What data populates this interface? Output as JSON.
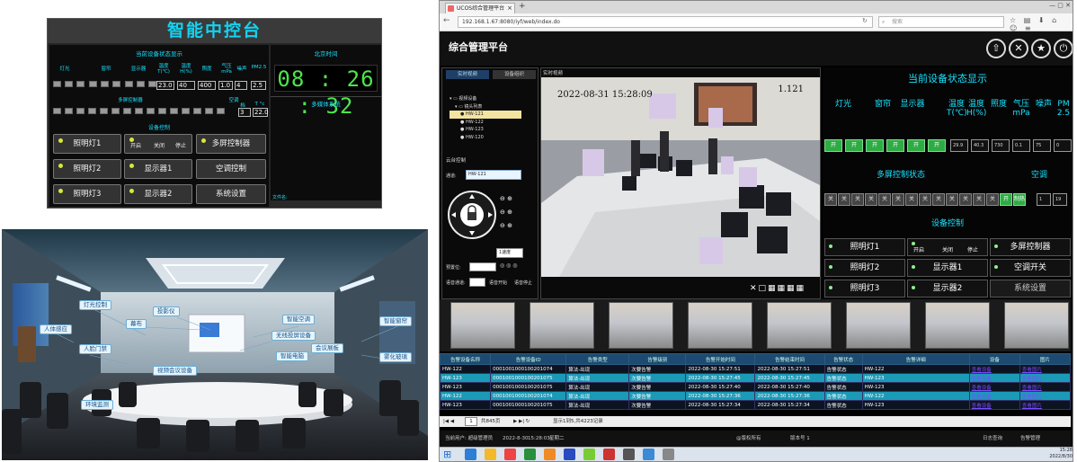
{
  "console": {
    "title": "智能中控台",
    "status_title": "当前设备状态显示",
    "time_title": "北京时间",
    "clock": "08 : 26 : 32",
    "labels": [
      "灯光",
      "窗帘",
      "显示器",
      "温度 T(℃)",
      "温度 H(%)",
      "照度",
      "气压 mPa",
      "噪声",
      "PM2.5"
    ],
    "values": [
      "23.0",
      "40",
      "400",
      "1.0",
      "4",
      "2.5"
    ],
    "multi_title": "多屏控制器",
    "ac_title": "空调",
    "ac_sub": [
      "档",
      "T °c"
    ],
    "ac_values": [
      "3",
      "22.0"
    ],
    "media_title": "多媒体系统",
    "device_title": "设备控制",
    "buttons": [
      "照明灯1",
      "照明灯2",
      "照明灯3",
      "显示器1",
      "显示器2",
      "多屏控制器",
      "空调控制",
      "系统设置"
    ],
    "small_buttons": [
      "开启",
      "关闭",
      "停止"
    ],
    "file_label": "文件名:"
  },
  "room": {
    "tags": [
      "灯光控制",
      "幕布",
      "投影仪",
      "智能空调",
      "智能窗帘",
      "人体感应",
      "人脸门禁",
      "无线投屏设备",
      "智能电脑",
      "会议展板",
      "雾化玻璃",
      "视频会议设备",
      "环境监测"
    ]
  },
  "browser": {
    "tab_title": "UCOS综合管理平台",
    "url": "192.168.1.67:8080/iyf/web/index.do",
    "search_placeholder": "搜索",
    "app_title": "综合管理平台",
    "sub_tabs": [
      "实时视频",
      "设备组织"
    ],
    "video_header": "实时视频",
    "tree": [
      "视频设备",
      "镜头列表",
      "HW-121",
      "HW-122",
      "HW-123",
      "HW-120"
    ],
    "ptz_title": "云台控制",
    "channel_label": "通道:",
    "channel_value": "HW-121",
    "speed_value": "1速度",
    "preset_label": "预置位:",
    "voice_label": "语音通道:",
    "voice_buttons": [
      "语音开始",
      "语音停止"
    ],
    "osd_time": "2022-08-31 15:28:09",
    "osd_channel": "1.121",
    "status_title": "当前设备状态显示",
    "status_labels": [
      "灯光",
      "窗帘",
      "显示器",
      "温度 T(℃)",
      "温度 H(%)",
      "照度",
      "气压 mPa",
      "噪声",
      "PM 2.5"
    ],
    "status_switches": [
      "开",
      "开",
      "开",
      "开",
      "开",
      "开"
    ],
    "status_values": [
      "29.9",
      "40.3",
      "730",
      "0.1",
      "75",
      "0"
    ],
    "multi_title": "多屏控制状态",
    "ac_title": "空调",
    "multi_switches": [
      "关",
      "关",
      "关",
      "关",
      "关",
      "关",
      "关",
      "关",
      "关",
      "关",
      "关",
      "关",
      "关",
      "开",
      "制热"
    ],
    "ac_values": [
      "1",
      "19"
    ],
    "device_title": "设备控制",
    "device_buttons": [
      "照明灯1",
      "照明灯2",
      "照明灯3",
      "显示器1",
      "显示器2",
      "多屏控制器",
      "空调开关",
      "系统设置"
    ],
    "small_buttons": [
      "开启",
      "关闭",
      "停止"
    ],
    "table_headers": [
      "告警设备名称",
      "告警设备ID",
      "告警类型",
      "告警级别",
      "告警开始时间",
      "告警结束时间",
      "告警状态",
      "告警详细",
      "设备",
      "图片"
    ],
    "table_rows": [
      [
        "HW-122",
        "0001001000100201074",
        "算法-出现",
        "次要告警",
        "2022-08-30 15:27:51",
        "2022-08-30 15:27:51",
        "告警状态",
        "HW-122",
        "查看设备",
        "查看图片"
      ],
      [
        "HW-123",
        "0001001000100201075",
        "算法-出现",
        "次要告警",
        "2022-08-30 15:27:45",
        "2022-08-30 15:27:45",
        "告警状态",
        "HW-123",
        "查看设备",
        "查看图片"
      ],
      [
        "HW-123",
        "0001001000100201075",
        "算法-出现",
        "次要告警",
        "2022-08-30 15:27:40",
        "2022-08-30 15:27:40",
        "告警状态",
        "HW-123",
        "查看设备",
        "查看图片"
      ],
      [
        "HW-122",
        "0001001000100201074",
        "算法-出现",
        "次要告警",
        "2022-08-30 15:27:36",
        "2022-08-30 15:27:36",
        "告警状态",
        "HW-122",
        "查看设备",
        "查看图片"
      ],
      [
        "HW-123",
        "0001001000100201075",
        "算法-出现",
        "次要告警",
        "2022-08-30 15:27:34",
        "2022-08-30 15:27:34",
        "告警状态",
        "HW-123",
        "查看设备",
        "查看图片"
      ]
    ],
    "pager": "显示1到5,共4223记录",
    "pager_page": "1",
    "pager_total": "共845页",
    "footer_user": "当前用户: 超级管理员",
    "footer_date": "2022-8-30",
    "footer_time": "15:28:03",
    "footer_weekday": "星期二",
    "footer_copy": "@版权所有",
    "footer_version": "版本号 1",
    "footer_links": [
      "日志查询",
      "告警管理"
    ],
    "clock_date": "2022/8/30",
    "clock_time": "15:28"
  }
}
